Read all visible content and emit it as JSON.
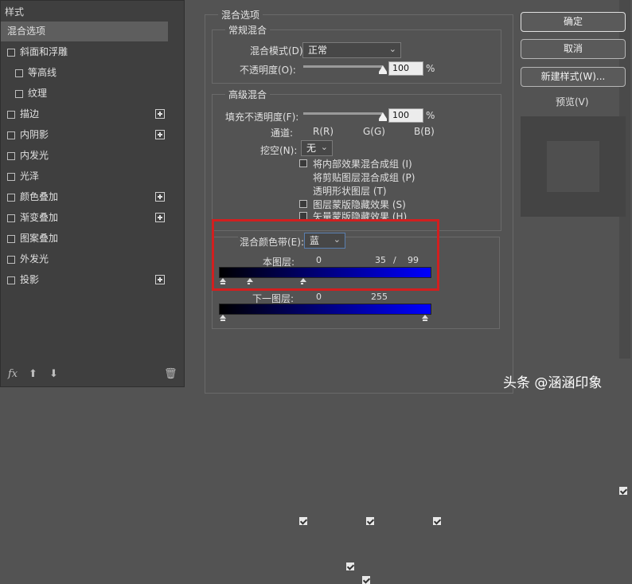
{
  "left_panel": {
    "header": "样式",
    "items": [
      {
        "label": "混合选项",
        "selected": true,
        "checkbox": false,
        "plus": false,
        "indent": false
      },
      {
        "label": "斜面和浮雕",
        "checkbox": true,
        "plus": false,
        "indent": false
      },
      {
        "label": "等高线",
        "checkbox": true,
        "plus": false,
        "indent": true
      },
      {
        "label": "纹理",
        "checkbox": true,
        "plus": false,
        "indent": true
      },
      {
        "label": "描边",
        "checkbox": true,
        "plus": true,
        "indent": false
      },
      {
        "label": "内阴影",
        "checkbox": true,
        "plus": true,
        "indent": false
      },
      {
        "label": "内发光",
        "checkbox": true,
        "plus": false,
        "indent": false
      },
      {
        "label": "光泽",
        "checkbox": true,
        "plus": false,
        "indent": false
      },
      {
        "label": "颜色叠加",
        "checkbox": true,
        "plus": true,
        "indent": false
      },
      {
        "label": "渐变叠加",
        "checkbox": true,
        "plus": true,
        "indent": false
      },
      {
        "label": "图案叠加",
        "checkbox": true,
        "plus": false,
        "indent": false
      },
      {
        "label": "外发光",
        "checkbox": true,
        "plus": false,
        "indent": false
      },
      {
        "label": "投影",
        "checkbox": true,
        "plus": true,
        "indent": false
      }
    ],
    "footer": {
      "fx": "fx",
      "up": "⬆",
      "down": "⬇",
      "trash": "🗑"
    }
  },
  "blend_options": {
    "title": "混合选项",
    "general": {
      "title": "常规混合",
      "blend_mode_label": "混合模式(D):",
      "blend_mode_value": "正常",
      "opacity_label": "不透明度(O):",
      "opacity_value": "100",
      "opacity_unit": "%",
      "opacity_level": 1.0
    },
    "advanced": {
      "title": "高级混合",
      "fill_opacity_label": "填充不透明度(F):",
      "fill_opacity_value": "100",
      "fill_opacity_unit": "%",
      "fill_opacity_level": 1.0,
      "channels_label": "通道:",
      "channels": [
        {
          "label": "R(R)",
          "checked": true
        },
        {
          "label": "G(G)",
          "checked": true
        },
        {
          "label": "B(B)",
          "checked": true
        }
      ],
      "knockout_label": "挖空(N):",
      "knockout_value": "无",
      "options": [
        {
          "label": "将内部效果混合成组 (I)",
          "checked": false
        },
        {
          "label": "将剪贴图层混合成组 (P)",
          "checked": true
        },
        {
          "label": "透明形状图层 (T)",
          "checked": true
        },
        {
          "label": "图层蒙版隐藏效果 (S)",
          "checked": false
        },
        {
          "label": "矢量蒙版隐藏效果 (H)",
          "checked": false
        }
      ]
    },
    "blend_if": {
      "label": "混合颜色带(E):",
      "value": "蓝",
      "this_layer_label": "本图层:",
      "this_layer_min": "0",
      "this_layer_split_a": "35",
      "this_layer_sep": "/",
      "this_layer_split_b": "99",
      "underlying_label": "下一图层:",
      "underlying_min": "0",
      "underlying_max": "255",
      "gradient_start": "#000000",
      "gradient_end": "#0000ff"
    }
  },
  "buttons": {
    "ok": "确定",
    "cancel": "取消",
    "new_style": "新建样式(W)...",
    "preview_label": "预览(V)",
    "preview_checked": true
  },
  "highlight_color": "#d21f1f",
  "watermark": "头条 @涵涵印象"
}
